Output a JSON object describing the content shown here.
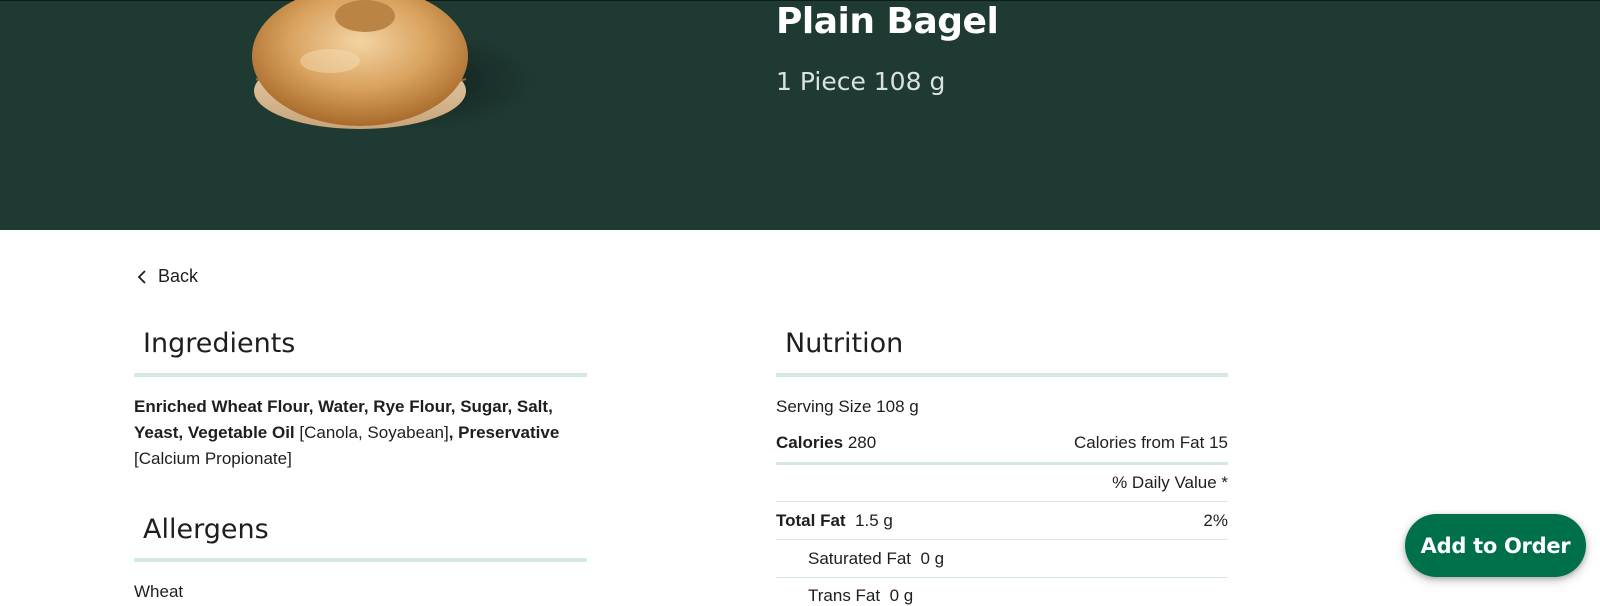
{
  "product": {
    "name": "Plain Bagel",
    "serving": "1 Piece 108 g",
    "image": "bagel-photo"
  },
  "nav": {
    "back_label": "Back"
  },
  "ingredients": {
    "title": "Ingredients",
    "parts": [
      {
        "text": "Enriched Wheat Flour, Water, Rye Flour, Sugar, Salt, Yeast, Vegetable Oil",
        "bold": true
      },
      {
        "text": " [Canola, Soyabean]",
        "bold": false
      },
      {
        "text": ", Preservative",
        "bold": true
      },
      {
        "text": " [Calcium Propionate]",
        "bold": false
      }
    ]
  },
  "allergens": {
    "title": "Allergens",
    "text": "Wheat"
  },
  "nutrition": {
    "title": "Nutrition",
    "serving_size": "Serving Size 108 g",
    "calories_label": "Calories",
    "calories_value": "280",
    "calories_from_fat": "Calories from Fat 15",
    "daily_value_header": "% Daily Value *",
    "rows": [
      {
        "label": "Total Fat",
        "value": "1.5 g",
        "dv": "2%"
      },
      {
        "label": "Saturated Fat",
        "value": "0 g",
        "dv": ""
      },
      {
        "label": "Trans Fat",
        "value": "0 g",
        "dv": ""
      }
    ]
  },
  "cta": {
    "add_label": "Add to Order"
  },
  "colors": {
    "hero_bg": "#1f3933",
    "rule": "#d4e9e2",
    "cta_bg": "#00704a"
  }
}
